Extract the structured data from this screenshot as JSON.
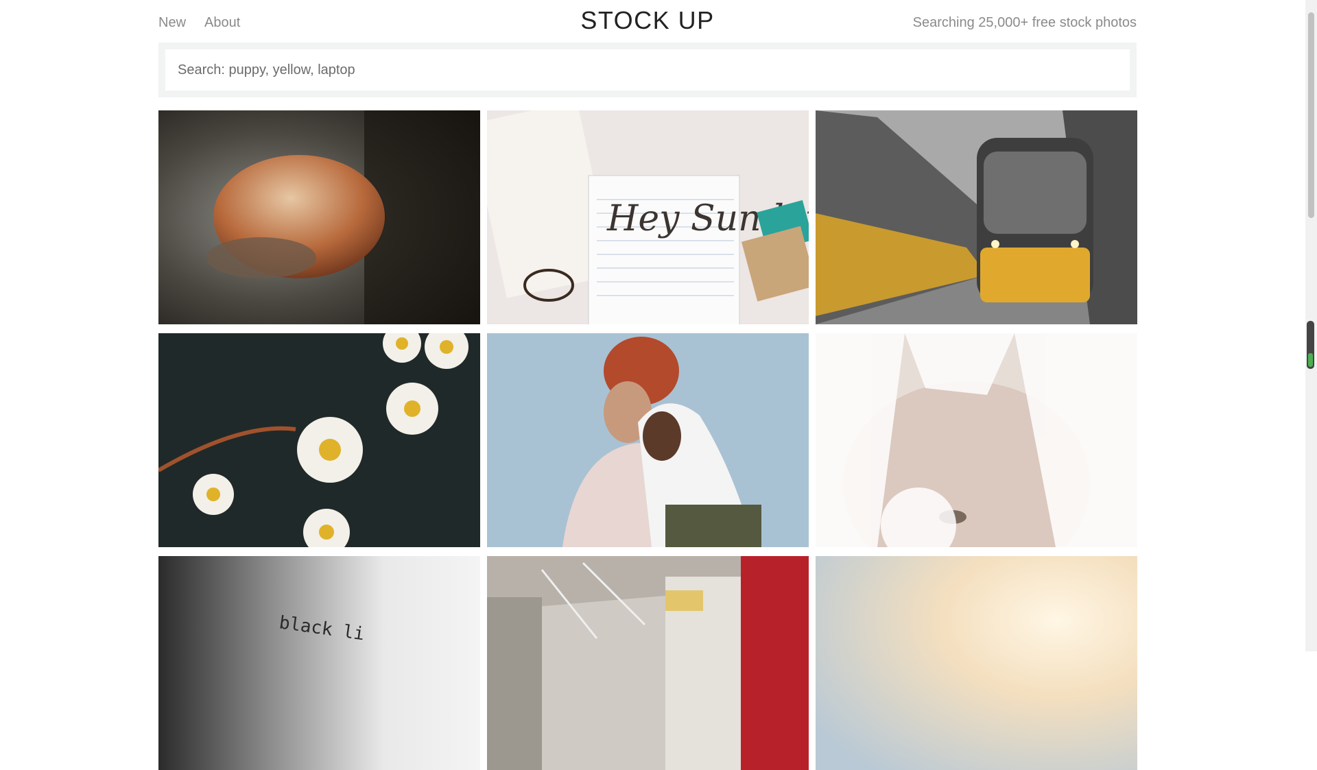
{
  "header": {
    "nav": [
      {
        "label": "New"
      },
      {
        "label": "About"
      }
    ],
    "logo": "STOCK UP",
    "tagline": "Searching 25,000+ free stock photos"
  },
  "search": {
    "placeholder": "Search: puppy, yellow, laptop"
  },
  "photos": [
    {
      "subject": "hands holding loaf of bread",
      "tone": "#3a332c"
    },
    {
      "subject": "notebook with Hey Sunday handwriting",
      "tone": "#e8e2df",
      "text": "Hey Sunday"
    },
    {
      "subject": "yellow tram on city street",
      "tone": "#6d6d6d"
    },
    {
      "subject": "daisies on dark background",
      "tone": "#2c2f22"
    },
    {
      "subject": "two women wearing headscarves",
      "tone": "#a9c1d4"
    },
    {
      "subject": "face behind white lace",
      "tone": "#e3dcd6"
    },
    {
      "subject": "white fabric with typed text",
      "tone": "#8e8e8e",
      "text": "black li"
    },
    {
      "subject": "interior of a room with red tiles",
      "tone": "#b8b4ae"
    },
    {
      "subject": "sunset sky",
      "tone": "#efd8b6"
    }
  ],
  "colors": {
    "search_band": "#f1f4f3",
    "nav_text": "#8a8a8a",
    "logo_text": "#222222"
  }
}
